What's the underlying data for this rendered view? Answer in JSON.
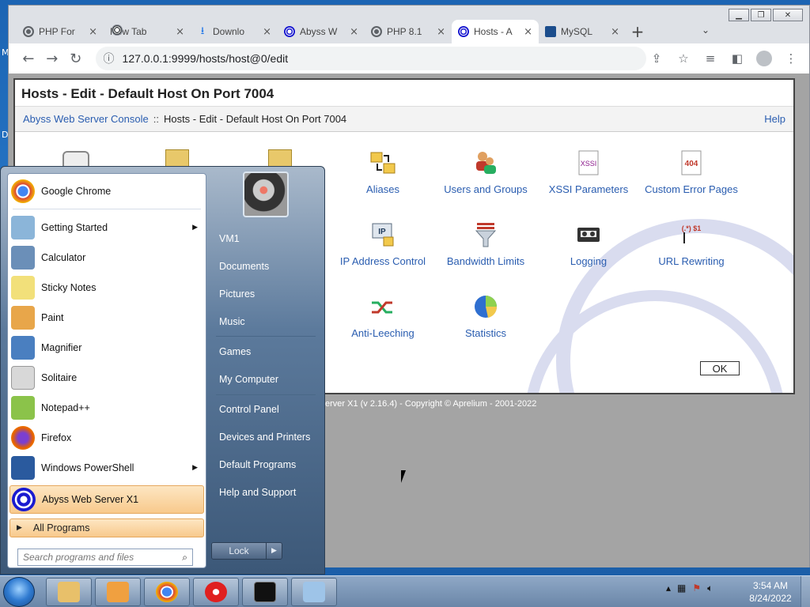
{
  "desktop": {
    "letters": [
      "M",
      "D"
    ]
  },
  "browser": {
    "tabs": [
      {
        "label": "PHP For",
        "icon": "php-icon"
      },
      {
        "label": "New Tab",
        "icon": "chrome-icon"
      },
      {
        "label": "Downlo",
        "icon": "download-icon"
      },
      {
        "label": "Abyss W",
        "icon": "abyss-icon"
      },
      {
        "label": "PHP 8.1",
        "icon": "php-icon"
      },
      {
        "label": "Hosts - A",
        "icon": "abyss-icon",
        "active": true
      },
      {
        "label": "MySQL",
        "icon": "mysql-icon"
      }
    ],
    "tab_close": "×",
    "new_tab": "+",
    "url": "127.0.0.1:9999/hosts/host@0/edit"
  },
  "console": {
    "title": "Hosts - Edit - Default Host On Port 7004",
    "breadcrumb_link": "Abyss Web Server Console",
    "breadcrumb_sep": "::",
    "breadcrumb_current": "Hosts - Edit - Default Host On Port 7004",
    "help": "Help",
    "items": [
      {
        "label": "Aliases",
        "icon": "aliases-icon"
      },
      {
        "label": "Users and Groups",
        "icon": "users-groups-icon"
      },
      {
        "label": "XSSI Parameters",
        "icon": "xssi-icon",
        "icon_text": "XSSI"
      },
      {
        "label": "Custom Error Pages",
        "icon": "error-page-icon",
        "icon_text": "404"
      },
      {
        "label": "IP Address Control",
        "icon": "ip-control-icon",
        "icon_text": "IP"
      },
      {
        "label": "Bandwidth Limits",
        "icon": "bandwidth-icon"
      },
      {
        "label": "Logging",
        "icon": "logging-icon"
      },
      {
        "label": "URL Rewriting",
        "icon": "url-rewrite-icon",
        "icon_text": "(.*) $1"
      },
      {
        "label": "Anti-Leeching",
        "icon": "anti-leech-icon"
      },
      {
        "label": "Statistics",
        "icon": "statistics-icon"
      }
    ],
    "ok": "OK",
    "footer": "erver X1 (v 2.16.4) - Copyright © Aprelium - 2001-2022"
  },
  "start_menu": {
    "programs": [
      {
        "label": "Google Chrome",
        "icon": "chrome-icon",
        "color": "#4285f4"
      },
      {
        "label": "Getting Started",
        "icon": "getting-started-icon",
        "color": "#8bb5d9",
        "submenu": true
      },
      {
        "label": "Calculator",
        "icon": "calculator-icon",
        "color": "#6b8fb8"
      },
      {
        "label": "Sticky Notes",
        "icon": "sticky-notes-icon",
        "color": "#f2e07a"
      },
      {
        "label": "Paint",
        "icon": "paint-icon",
        "color": "#e8a64a"
      },
      {
        "label": "Magnifier",
        "icon": "magnifier-icon",
        "color": "#4a7fc0"
      },
      {
        "label": "Solitaire",
        "icon": "solitaire-icon",
        "color": "#d8d8d8"
      },
      {
        "label": "Notepad++",
        "icon": "notepadpp-icon",
        "color": "#8bc34a"
      },
      {
        "label": "Firefox",
        "icon": "firefox-icon",
        "color": "#e66000"
      },
      {
        "label": "Windows PowerShell",
        "icon": "powershell-icon",
        "color": "#2a5a9e",
        "submenu": true
      },
      {
        "label": "Abyss Web Server X1",
        "icon": "abyss-icon",
        "color": "#1a1ad0",
        "highlight": true
      }
    ],
    "all_programs": "All Programs",
    "search_placeholder": "Search programs and files",
    "right_links": [
      "VM1",
      "Documents",
      "Pictures",
      "Music",
      "Games",
      "My Computer",
      "Control Panel",
      "Devices and Printers",
      "Default Programs",
      "Help and Support"
    ],
    "lock": "Lock"
  },
  "taskbar": {
    "tasks": [
      {
        "name": "explorer-icon",
        "color": "#e8c06a"
      },
      {
        "name": "media-player-icon",
        "color": "#f0a040"
      },
      {
        "name": "chrome-icon",
        "color": "#4285f4"
      },
      {
        "name": "youtube-music-icon",
        "color": "#e02020"
      },
      {
        "name": "cmd-icon",
        "color": "#111111"
      },
      {
        "name": "notepad-icon",
        "color": "#9ec4e8"
      }
    ],
    "time": "3:54 AM",
    "date": "8/24/2022"
  }
}
